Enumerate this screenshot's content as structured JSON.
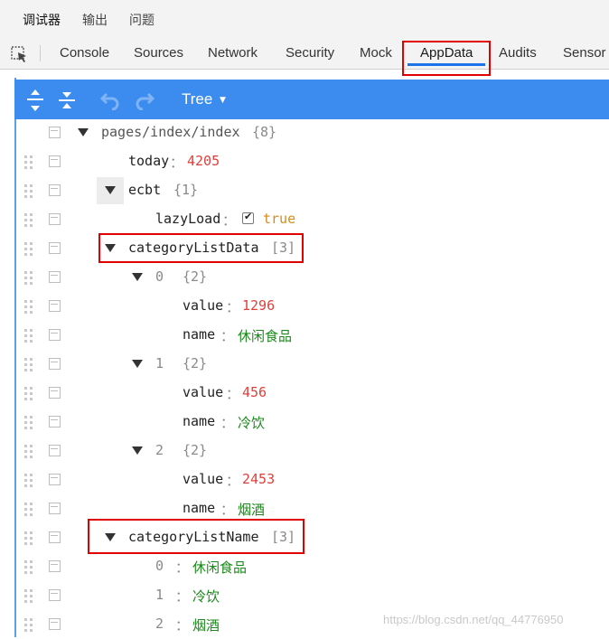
{
  "top_tabs": [
    "调试器",
    "输出",
    "问题"
  ],
  "tool_tabs": [
    "Console",
    "Sources",
    "Network",
    "Security",
    "Mock",
    "AppData",
    "Audits",
    "Sensor"
  ],
  "toolbar": {
    "view_mode": "Tree"
  },
  "tree": {
    "root": "pages/index/index",
    "root_count": "{8}",
    "today_key": "today",
    "today_value": "4205",
    "ecbt_key": "ecbt",
    "ecbt_count": "{1}",
    "lazyload_key": "lazyLoad",
    "lazyload_value": "true",
    "cld_key": "categoryListData",
    "cld_count": "[3]",
    "items": [
      {
        "index": "0",
        "count": "{2}",
        "value": "1296",
        "name": "休闲食品"
      },
      {
        "index": "1",
        "count": "{2}",
        "value": "456",
        "name": "冷饮"
      },
      {
        "index": "2",
        "count": "{2}",
        "value": "2453",
        "name": "烟酒"
      }
    ],
    "value_key": "value",
    "name_key": "name",
    "cln_key": "categoryListName",
    "cln_count": "[3]",
    "names": [
      {
        "index": "0",
        "value": "休闲食品"
      },
      {
        "index": "1",
        "value": "冷饮"
      },
      {
        "index": "2",
        "value": "烟酒"
      }
    ],
    "colon": "："
  },
  "watermark": "https://blog.csdn.net/qq_44776950",
  "colors": {
    "accent": "#3c8cf0",
    "highlight_box": "#e00000",
    "number": "#e0403c",
    "string": "#1a8a1a",
    "boolean": "#d98a1c"
  }
}
